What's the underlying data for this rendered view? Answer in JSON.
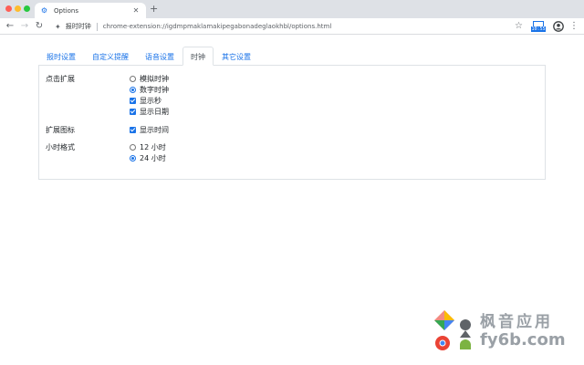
{
  "browser": {
    "tab": {
      "title": "Options"
    },
    "address": {
      "extension_name": "报时时钟",
      "url": "chrome-extension://igdmpmaklamakipegabonadeglaokhbl/options.html"
    },
    "extension_badge": "10:55"
  },
  "tabs": [
    {
      "label": "报时设置",
      "active": false
    },
    {
      "label": "自定义提醒",
      "active": false
    },
    {
      "label": "语音设置",
      "active": false
    },
    {
      "label": "时钟",
      "active": true
    },
    {
      "label": "其它设置",
      "active": false
    }
  ],
  "settings": {
    "click_extension": {
      "label": "点击扩展",
      "options": [
        {
          "label": "模拟时钟",
          "type": "radio",
          "checked": false
        },
        {
          "label": "数字时钟",
          "type": "radio",
          "checked": true
        },
        {
          "label": "显示秒",
          "type": "checkbox",
          "checked": true
        },
        {
          "label": "显示日期",
          "type": "checkbox",
          "checked": true
        }
      ]
    },
    "extension_icon": {
      "label": "扩展图标",
      "options": [
        {
          "label": "显示时间",
          "type": "checkbox",
          "checked": true
        }
      ]
    },
    "hour_format": {
      "label": "小时格式",
      "options": [
        {
          "label": "12 小时",
          "type": "radio",
          "checked": false
        },
        {
          "label": "24 小时",
          "type": "radio",
          "checked": true
        }
      ]
    }
  },
  "watermark": {
    "line1": "枫音应用",
    "line2": "fy6b.com"
  },
  "colors": {
    "accent": "#1a73e8",
    "tab_border": "#dee2e6",
    "chrome_bg": "#dee1e6"
  }
}
